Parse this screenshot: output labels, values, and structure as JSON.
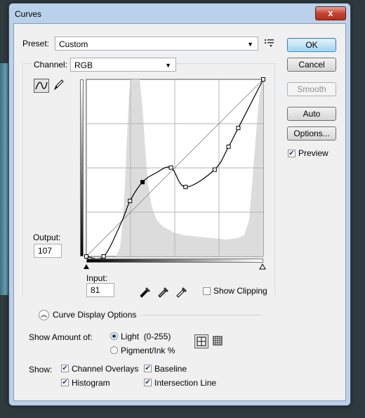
{
  "window": {
    "title": "Curves",
    "close_symbol": "x"
  },
  "preset": {
    "label": "Preset:",
    "value": "Custom"
  },
  "channel": {
    "label": "Channel:",
    "value": "RGB"
  },
  "buttons": {
    "ok": "OK",
    "cancel": "Cancel",
    "smooth": "Smooth",
    "auto": "Auto",
    "options": "Options..."
  },
  "preview": {
    "label": "Preview",
    "checked": true
  },
  "output": {
    "label": "Output:",
    "value": "107"
  },
  "input": {
    "label": "Input:",
    "value": "81"
  },
  "show_clipping": {
    "label": "Show Clipping",
    "checked": false
  },
  "curve_display_options": {
    "label": "Curve Display Options"
  },
  "show_amount": {
    "label": "Show Amount of:",
    "light_label": "Light  (0-255)",
    "pigment_label": "Pigment/Ink %",
    "selected": "light"
  },
  "show": {
    "label": "Show:",
    "channel_overlays": "Channel Overlays",
    "baseline": "Baseline",
    "histogram": "Histogram",
    "intersection_line": "Intersection Line"
  },
  "curve_points": [
    [
      0,
      0
    ],
    [
      25,
      0
    ],
    [
      50,
      48
    ],
    [
      63,
      80
    ],
    [
      81,
      107
    ],
    [
      100,
      120
    ],
    [
      122,
      128
    ],
    [
      143,
      100
    ],
    [
      185,
      125
    ],
    [
      205,
      158
    ],
    [
      219,
      185
    ],
    [
      255,
      255
    ]
  ],
  "selected_point_index": 4,
  "icons": [
    "curve-tool-icon",
    "pencil-tool-icon",
    "preset-menu-icon",
    "black-eyedropper-icon",
    "gray-eyedropper-icon",
    "white-eyedropper-icon",
    "collapse-icon",
    "grid-4x4-icon",
    "grid-10x10-icon"
  ]
}
